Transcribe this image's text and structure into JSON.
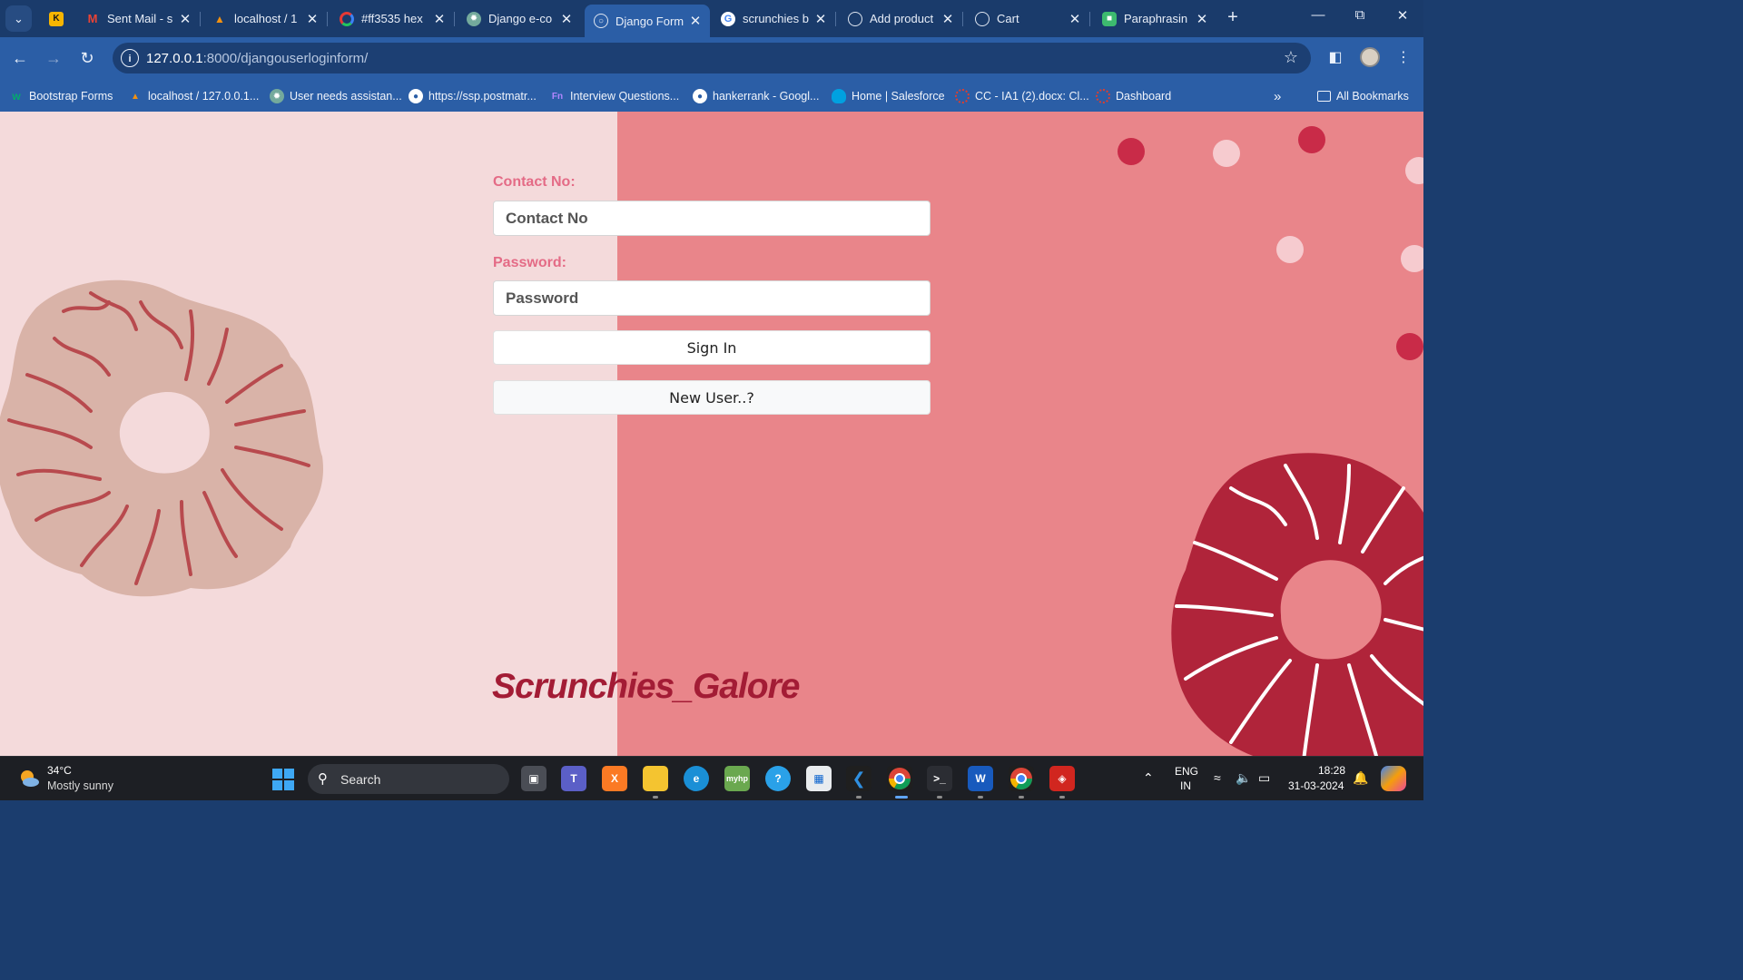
{
  "browser": {
    "tabs": [
      {
        "title": "",
        "icon": "k-icon",
        "color": "#f7b500",
        "active": false
      },
      {
        "title": "Sent Mail - s",
        "icon": "gmail-icon",
        "color": "#ea4335",
        "active": false
      },
      {
        "title": "localhost / 1",
        "icon": "phpmyadmin-icon",
        "color": "#f29111",
        "active": false
      },
      {
        "title": "#ff3535 hex",
        "icon": "colorhex-icon",
        "color": "#e53935",
        "active": false
      },
      {
        "title": "Django e-co",
        "icon": "chatgpt-icon",
        "color": "#74aa9c",
        "active": false
      },
      {
        "title": "Django Form",
        "icon": "globe-icon",
        "color": "#dfe6f1",
        "active": true
      },
      {
        "title": "scrunchies b",
        "icon": "google-icon",
        "color": "#ffffff",
        "active": false
      },
      {
        "title": "Add product",
        "icon": "globe-icon",
        "color": "#dfe6f1",
        "active": false
      },
      {
        "title": "Cart",
        "icon": "globe-icon",
        "color": "#dfe6f1",
        "active": false
      },
      {
        "title": "Paraphrasin",
        "icon": "robot-icon",
        "color": "#3dba6f",
        "active": false
      }
    ],
    "url_host": "127.0.0.1",
    "url_rest": ":8000/djangouserloginform/",
    "bookmarks": [
      {
        "label": "Bootstrap Forms",
        "icon": "w3-icon",
        "color": "#04aa6d"
      },
      {
        "label": "localhost / 127.0.0.1...",
        "icon": "phpmyadmin-icon",
        "color": "#f29111"
      },
      {
        "label": "User needs assistan...",
        "icon": "chatgpt-icon",
        "color": "#74aa9c"
      },
      {
        "label": "https://ssp.postmatr...",
        "icon": "globe-icon",
        "color": "#ffffff"
      },
      {
        "label": "Interview Questions...",
        "icon": "fn-icon",
        "color": "#7b5cd6"
      },
      {
        "label": "hankerrank - Googl...",
        "icon": "globe-icon",
        "color": "#ffffff"
      },
      {
        "label": "Home | Salesforce",
        "icon": "salesforce-icon",
        "color": "#00a1e0"
      },
      {
        "label": "CC - IA1 (2).docx: Cl...",
        "icon": "canvas-icon",
        "color": "#e03e2d"
      },
      {
        "label": "Dashboard",
        "icon": "canvas-icon",
        "color": "#e03e2d"
      }
    ],
    "all_bookmarks": "All Bookmarks"
  },
  "form": {
    "contact_label": "Contact No:",
    "contact_placeholder": "Contact No",
    "password_label": "Password:",
    "password_placeholder": "Password",
    "signin_label": "Sign In",
    "newuser_label": "New User..?"
  },
  "brand": {
    "name": "Scrunchies_Galore"
  },
  "colors": {
    "left_bg": "#f4dadb",
    "right_bg": "#e9858a",
    "label": "#e46b86",
    "brand": "#a31c35"
  },
  "taskbar": {
    "temperature": "34°C",
    "weather": "Mostly sunny",
    "search": "Search",
    "lang": "ENG",
    "region": "IN",
    "time": "18:28",
    "date": "31-03-2024"
  }
}
